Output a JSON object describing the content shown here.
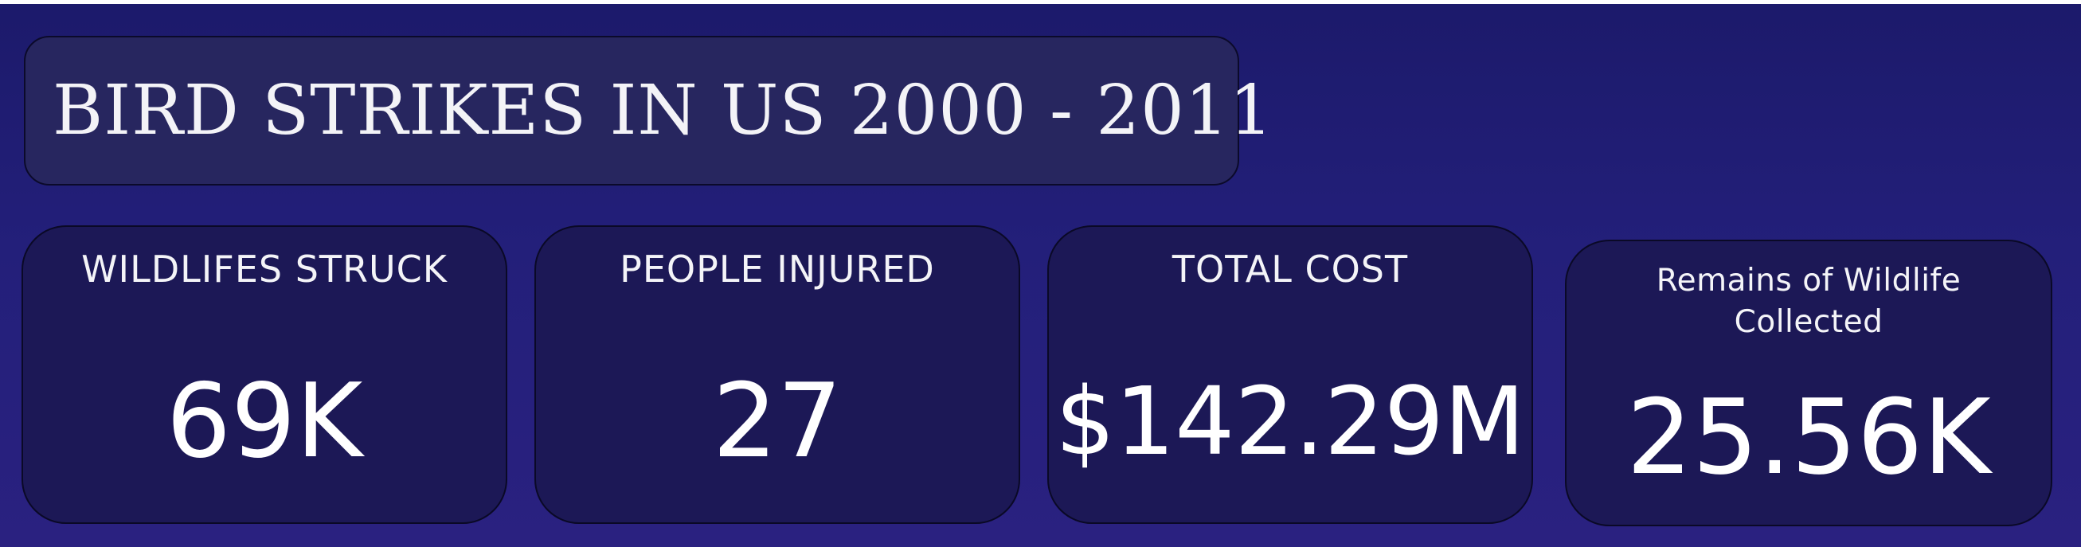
{
  "header": {
    "title": "BIRD STRIKES IN US 2000 - 2011"
  },
  "kpis": [
    {
      "label": "WILDLIFES STRUCK",
      "value": "69K"
    },
    {
      "label": "PEOPLE INJURED",
      "value": "27"
    },
    {
      "label": "TOTAL COST",
      "value": "$142.29M"
    },
    {
      "label_line1": "Remains of Wildlife",
      "label_line2": "Collected",
      "value": "25.56K"
    }
  ],
  "colors": {
    "background": "#231f7a",
    "card_background": "#1c1856",
    "title_background": "#27265f",
    "text": "#ffffff"
  }
}
